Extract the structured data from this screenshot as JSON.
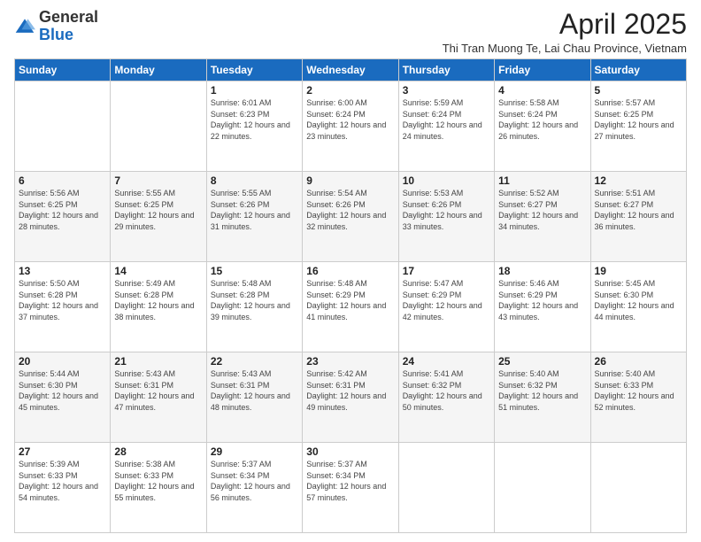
{
  "logo": {
    "general": "General",
    "blue": "Blue"
  },
  "header": {
    "month": "April 2025",
    "subtitle": "Thi Tran Muong Te, Lai Chau Province, Vietnam"
  },
  "days_of_week": [
    "Sunday",
    "Monday",
    "Tuesday",
    "Wednesday",
    "Thursday",
    "Friday",
    "Saturday"
  ],
  "weeks": [
    [
      {
        "day": "",
        "info": ""
      },
      {
        "day": "",
        "info": ""
      },
      {
        "day": "1",
        "info": "Sunrise: 6:01 AM\nSunset: 6:23 PM\nDaylight: 12 hours and 22 minutes."
      },
      {
        "day": "2",
        "info": "Sunrise: 6:00 AM\nSunset: 6:24 PM\nDaylight: 12 hours and 23 minutes."
      },
      {
        "day": "3",
        "info": "Sunrise: 5:59 AM\nSunset: 6:24 PM\nDaylight: 12 hours and 24 minutes."
      },
      {
        "day": "4",
        "info": "Sunrise: 5:58 AM\nSunset: 6:24 PM\nDaylight: 12 hours and 26 minutes."
      },
      {
        "day": "5",
        "info": "Sunrise: 5:57 AM\nSunset: 6:25 PM\nDaylight: 12 hours and 27 minutes."
      }
    ],
    [
      {
        "day": "6",
        "info": "Sunrise: 5:56 AM\nSunset: 6:25 PM\nDaylight: 12 hours and 28 minutes."
      },
      {
        "day": "7",
        "info": "Sunrise: 5:55 AM\nSunset: 6:25 PM\nDaylight: 12 hours and 29 minutes."
      },
      {
        "day": "8",
        "info": "Sunrise: 5:55 AM\nSunset: 6:26 PM\nDaylight: 12 hours and 31 minutes."
      },
      {
        "day": "9",
        "info": "Sunrise: 5:54 AM\nSunset: 6:26 PM\nDaylight: 12 hours and 32 minutes."
      },
      {
        "day": "10",
        "info": "Sunrise: 5:53 AM\nSunset: 6:26 PM\nDaylight: 12 hours and 33 minutes."
      },
      {
        "day": "11",
        "info": "Sunrise: 5:52 AM\nSunset: 6:27 PM\nDaylight: 12 hours and 34 minutes."
      },
      {
        "day": "12",
        "info": "Sunrise: 5:51 AM\nSunset: 6:27 PM\nDaylight: 12 hours and 36 minutes."
      }
    ],
    [
      {
        "day": "13",
        "info": "Sunrise: 5:50 AM\nSunset: 6:28 PM\nDaylight: 12 hours and 37 minutes."
      },
      {
        "day": "14",
        "info": "Sunrise: 5:49 AM\nSunset: 6:28 PM\nDaylight: 12 hours and 38 minutes."
      },
      {
        "day": "15",
        "info": "Sunrise: 5:48 AM\nSunset: 6:28 PM\nDaylight: 12 hours and 39 minutes."
      },
      {
        "day": "16",
        "info": "Sunrise: 5:48 AM\nSunset: 6:29 PM\nDaylight: 12 hours and 41 minutes."
      },
      {
        "day": "17",
        "info": "Sunrise: 5:47 AM\nSunset: 6:29 PM\nDaylight: 12 hours and 42 minutes."
      },
      {
        "day": "18",
        "info": "Sunrise: 5:46 AM\nSunset: 6:29 PM\nDaylight: 12 hours and 43 minutes."
      },
      {
        "day": "19",
        "info": "Sunrise: 5:45 AM\nSunset: 6:30 PM\nDaylight: 12 hours and 44 minutes."
      }
    ],
    [
      {
        "day": "20",
        "info": "Sunrise: 5:44 AM\nSunset: 6:30 PM\nDaylight: 12 hours and 45 minutes."
      },
      {
        "day": "21",
        "info": "Sunrise: 5:43 AM\nSunset: 6:31 PM\nDaylight: 12 hours and 47 minutes."
      },
      {
        "day": "22",
        "info": "Sunrise: 5:43 AM\nSunset: 6:31 PM\nDaylight: 12 hours and 48 minutes."
      },
      {
        "day": "23",
        "info": "Sunrise: 5:42 AM\nSunset: 6:31 PM\nDaylight: 12 hours and 49 minutes."
      },
      {
        "day": "24",
        "info": "Sunrise: 5:41 AM\nSunset: 6:32 PM\nDaylight: 12 hours and 50 minutes."
      },
      {
        "day": "25",
        "info": "Sunrise: 5:40 AM\nSunset: 6:32 PM\nDaylight: 12 hours and 51 minutes."
      },
      {
        "day": "26",
        "info": "Sunrise: 5:40 AM\nSunset: 6:33 PM\nDaylight: 12 hours and 52 minutes."
      }
    ],
    [
      {
        "day": "27",
        "info": "Sunrise: 5:39 AM\nSunset: 6:33 PM\nDaylight: 12 hours and 54 minutes."
      },
      {
        "day": "28",
        "info": "Sunrise: 5:38 AM\nSunset: 6:33 PM\nDaylight: 12 hours and 55 minutes."
      },
      {
        "day": "29",
        "info": "Sunrise: 5:37 AM\nSunset: 6:34 PM\nDaylight: 12 hours and 56 minutes."
      },
      {
        "day": "30",
        "info": "Sunrise: 5:37 AM\nSunset: 6:34 PM\nDaylight: 12 hours and 57 minutes."
      },
      {
        "day": "",
        "info": ""
      },
      {
        "day": "",
        "info": ""
      },
      {
        "day": "",
        "info": ""
      }
    ]
  ]
}
